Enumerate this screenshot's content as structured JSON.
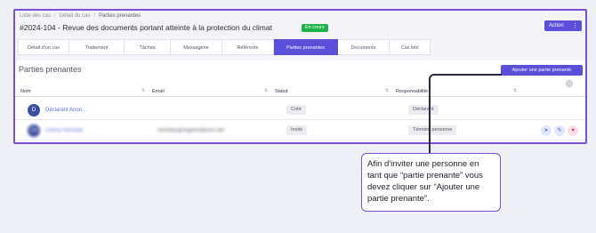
{
  "breadcrumb": [
    "Liste des cas",
    "Détail du cas",
    "Parties prenantes"
  ],
  "case": {
    "title": "#2024-104 - Revue des documents portant atteinte à la protection du climat",
    "status": "En cours"
  },
  "header": {
    "action_label": "Action",
    "more_icon": "more-vertical-icon"
  },
  "tabs": [
    {
      "label": "Détail d'un cas",
      "active": false
    },
    {
      "label": "Traitement",
      "active": false
    },
    {
      "label": "Tâches",
      "active": false
    },
    {
      "label": "Messagerie",
      "active": false
    },
    {
      "label": "Référents",
      "active": false
    },
    {
      "label": "Parties prenantes",
      "active": true
    },
    {
      "label": "Documents",
      "active": false
    },
    {
      "label": "Cas liés",
      "active": false
    }
  ],
  "section": {
    "title": "Parties prenantes",
    "add_label": "Ajouter une partie prenante"
  },
  "table": {
    "columns": [
      "Nom",
      "Email",
      "Statut",
      "Responsabilité"
    ],
    "rows": [
      {
        "avatar": "D",
        "name": "Déclarant Anon..",
        "email": "",
        "status": "Créé",
        "responsibility": "Déclarant",
        "blurred": false
      },
      {
        "avatar": "CN",
        "name": "Cherry Nicholas",
        "email": "nicholas@organisationX.net",
        "status": "Invité",
        "responsibility": "Témoin/ personne",
        "blurred": true
      }
    ]
  },
  "callout": {
    "text": "Afin d'inviter une personne en tant que “partie prenante” vous devez cliquer sur “Ajouter une partie prenante”."
  },
  "colors": {
    "accent": "#5b4ed8",
    "frame": "#7a4fd6",
    "success": "#1fb24a",
    "danger": "#d8354f"
  }
}
